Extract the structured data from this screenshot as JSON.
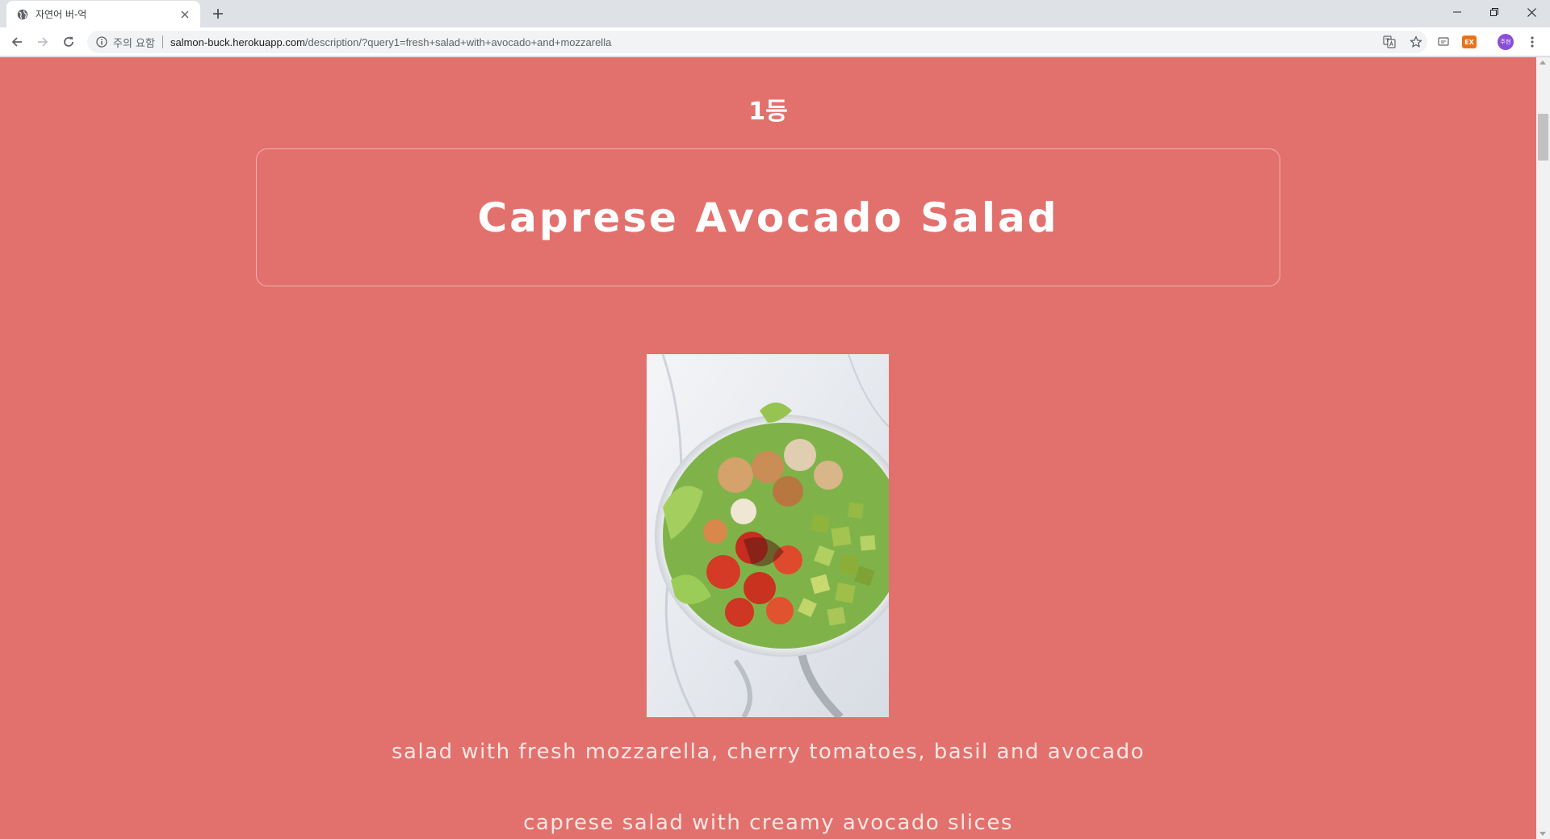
{
  "browser": {
    "tab_title": "자연어 버-억",
    "security_label": "주의 요함",
    "url_host": "salmon-buck.herokuapp.com",
    "url_path": "/description/?query1=fresh+salad+with+avocado+and+mozzarella",
    "avatar_label": "주현",
    "extension_label": "EX",
    "icons": [
      "globe-icon",
      "close-icon",
      "plus-icon",
      "minimize-icon",
      "restore-icon",
      "window-close-icon",
      "back-arrow-icon",
      "forward-arrow-icon",
      "reload-icon",
      "info-icon",
      "translate-icon",
      "star-icon",
      "cast-icon",
      "kebab-menu-icon"
    ]
  },
  "page": {
    "rank": "1등",
    "recipe_title": "Caprese Avocado Salad",
    "image_alt": "Caprese avocado salad bowl",
    "descriptions": [
      "salad with fresh mozzarella, cherry tomatoes, basil and avocado",
      "caprese salad with creamy avocado slices"
    ]
  },
  "colors": {
    "page_background": "#e2716d",
    "text_primary": "#ffffff",
    "text_secondary": "#fde6e3",
    "chrome_tabstrip": "#dee1e6"
  }
}
